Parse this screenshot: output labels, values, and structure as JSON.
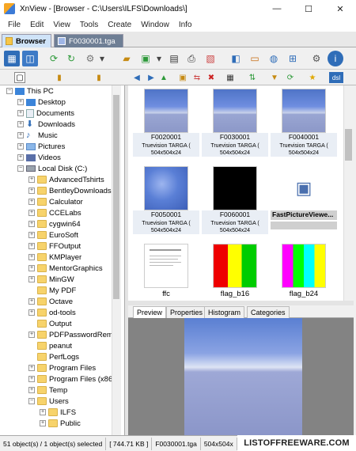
{
  "window": {
    "title": "XnView - [Browser - C:\\Users\\ILFS\\Downloads\\]",
    "minimize": "—",
    "maximize": "☐",
    "close": "✕"
  },
  "menu": [
    "File",
    "Edit",
    "View",
    "Tools",
    "Create",
    "Window",
    "Info"
  ],
  "tabs": [
    {
      "label": "Browser"
    },
    {
      "label": "F0030001.tga"
    }
  ],
  "tree": {
    "root": "This PC",
    "pc_items": [
      "Desktop",
      "Documents",
      "Downloads",
      "Music",
      "Pictures",
      "Videos"
    ],
    "disk": "Local Disk (C:)",
    "folders": [
      "AdvancedTshirts",
      "BentleyDownloads",
      "Calculator",
      "CCELabs",
      "cygwin64",
      "EuroSoft",
      "FFOutput",
      "KMPlayer",
      "MentorGraphics",
      "MinGW",
      "My PDF",
      "Octave",
      "od-tools",
      "Output",
      "PDFPasswordRem",
      "peanut",
      "PerfLogs",
      "Program Files",
      "Program Files (x86",
      "Temp",
      "Users"
    ],
    "subfolders": [
      "ILFS",
      "Public"
    ]
  },
  "thumbnails": [
    {
      "name": "F0020001",
      "type": "Truevision TARGA (",
      "size": "504x504x24"
    },
    {
      "name": "F0030001",
      "type": "Truevision TARGA (",
      "size": "504x504x24"
    },
    {
      "name": "F0040001",
      "type": "Truevision TARGA (",
      "size": "504x504x24"
    },
    {
      "name": "F0050001",
      "type": "Truevision TARGA (",
      "size": "504x504x24"
    },
    {
      "name": "F0060001",
      "type": "Truevision TARGA (",
      "size": "504x504x24"
    },
    {
      "name": "FastPictureViewe...",
      "type": "",
      "size": ""
    },
    {
      "name": "ffc",
      "type": "",
      "size": ""
    },
    {
      "name": "flag_b16",
      "type": "",
      "size": ""
    },
    {
      "name": "flag_b24",
      "type": "",
      "size": ""
    }
  ],
  "panel_tabs": [
    "Preview",
    "Properties",
    "Histogram",
    "Categories"
  ],
  "status": {
    "selection": "51 object(s) / 1 object(s) selected",
    "size": "[ 744.71 KB ]",
    "file": "F0030001.tga",
    "dims": "504x504x"
  },
  "watermark": "LISTOFFREEWARE.COM",
  "address": "dsl",
  "colors": {
    "accent": "#cfe3f8",
    "tab_dark": "#6f7f95",
    "folder": "#f7d36b",
    "preview_bg": "#838383"
  }
}
